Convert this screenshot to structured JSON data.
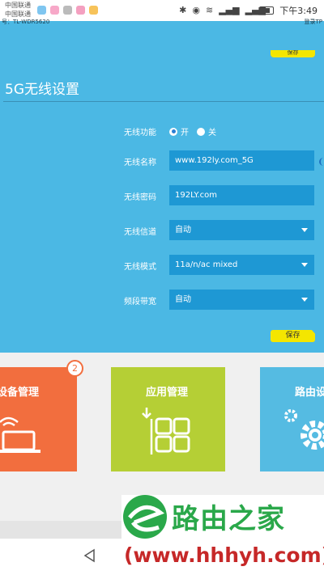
{
  "status_bar": {
    "carrier_1": "中国联通",
    "carrier_2": "中国联通",
    "icons": [
      "bluetooth-icon",
      "eye-icon",
      "wifi-icon",
      "signal-icon",
      "battery-icon"
    ],
    "sys_glyphs": [
      "✱",
      "◉",
      "≋",
      "▂▄▆",
      "▂▄▆"
    ],
    "time": "下午3:49"
  },
  "header_strip": {
    "left_text": "号：TL-WDR5620",
    "right_text": "登录TP"
  },
  "top_save_label": "保存",
  "settings": {
    "title": "5G无线设置",
    "wireless_function": {
      "label": "无线功能",
      "on_label": "开",
      "off_label": "关",
      "selected": "开"
    },
    "ssid": {
      "label": "无线名称",
      "value": "www.192ly.com_5G"
    },
    "password": {
      "label": "无线密码",
      "value": "192LY.com"
    },
    "channel": {
      "label": "无线信道",
      "value": "自动"
    },
    "mode": {
      "label": "无线模式",
      "value": "11a/n/ac mixed"
    },
    "bandwidth": {
      "label": "频段带宽",
      "value": "自动"
    },
    "save_label": "保存"
  },
  "tiles": [
    {
      "label": "设备管理",
      "badge": "2",
      "icon": "laptop-icon",
      "color": "#f26e3e"
    },
    {
      "label": "应用管理",
      "icon": "apps-grid-icon",
      "color": "#b5cf35"
    },
    {
      "label": "路由设",
      "icon": "gear-icon",
      "color": "#55bbe2"
    }
  ],
  "watermark": {
    "name": "路由之家",
    "url": "(www.hhhyh.com)"
  },
  "navbar": {
    "icon": "back-icon"
  }
}
